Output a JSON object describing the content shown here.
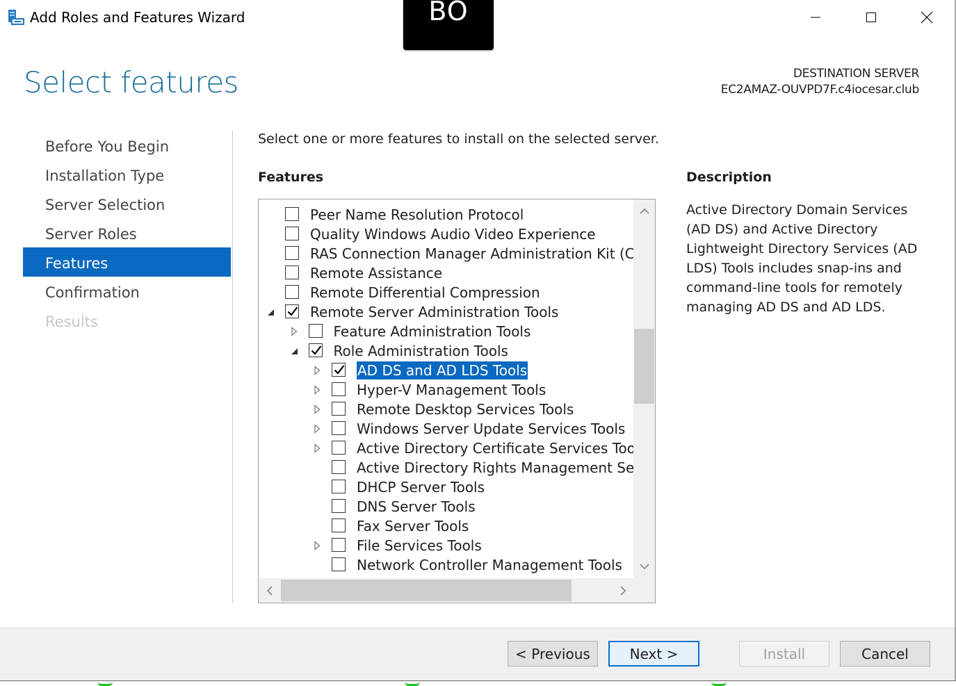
{
  "window": {
    "title": "Add Roles and Features Wizard",
    "overlay_text": "BO"
  },
  "page": {
    "title": "Select features",
    "destination_label": "DESTINATION SERVER",
    "destination_server": "EC2AMAZ-OUVPD7F.c4iocesar.club"
  },
  "nav": {
    "items": [
      {
        "label": "Before You Begin",
        "state": "normal"
      },
      {
        "label": "Installation Type",
        "state": "normal"
      },
      {
        "label": "Server Selection",
        "state": "normal"
      },
      {
        "label": "Server Roles",
        "state": "normal"
      },
      {
        "label": "Features",
        "state": "active"
      },
      {
        "label": "Confirmation",
        "state": "normal"
      },
      {
        "label": "Results",
        "state": "disabled"
      }
    ]
  },
  "content": {
    "intro": "Select one or more features to install on the selected server.",
    "features_heading": "Features",
    "description_heading": "Description",
    "description": "Active Directory Domain Services (AD DS) and Active Directory Lightweight Directory Services (AD LDS) Tools includes snap-ins and command-line tools for remotely managing AD DS and AD LDS."
  },
  "features": [
    {
      "label": "Peer Name Resolution Protocol",
      "checked": false,
      "level": 0,
      "expander": "none"
    },
    {
      "label": "Quality Windows Audio Video Experience",
      "checked": false,
      "level": 0,
      "expander": "none"
    },
    {
      "label": "RAS Connection Manager Administration Kit (CMA",
      "checked": false,
      "level": 0,
      "expander": "none"
    },
    {
      "label": "Remote Assistance",
      "checked": false,
      "level": 0,
      "expander": "none"
    },
    {
      "label": "Remote Differential Compression",
      "checked": false,
      "level": 0,
      "expander": "none"
    },
    {
      "label": "Remote Server Administration Tools",
      "checked": true,
      "level": 0,
      "expander": "expanded"
    },
    {
      "label": "Feature Administration Tools",
      "checked": false,
      "level": 1,
      "expander": "collapsed"
    },
    {
      "label": "Role Administration Tools",
      "checked": true,
      "level": 1,
      "expander": "expanded"
    },
    {
      "label": "AD DS and AD LDS Tools",
      "checked": true,
      "level": 2,
      "expander": "collapsed",
      "selected": true
    },
    {
      "label": "Hyper-V Management Tools",
      "checked": false,
      "level": 2,
      "expander": "collapsed"
    },
    {
      "label": "Remote Desktop Services Tools",
      "checked": false,
      "level": 2,
      "expander": "collapsed"
    },
    {
      "label": "Windows Server Update Services Tools",
      "checked": false,
      "level": 2,
      "expander": "collapsed"
    },
    {
      "label": "Active Directory Certificate Services Tools",
      "checked": false,
      "level": 2,
      "expander": "collapsed"
    },
    {
      "label": "Active Directory Rights Management Servic",
      "checked": false,
      "level": 2,
      "expander": "none"
    },
    {
      "label": "DHCP Server Tools",
      "checked": false,
      "level": 2,
      "expander": "none"
    },
    {
      "label": "DNS Server Tools",
      "checked": false,
      "level": 2,
      "expander": "none"
    },
    {
      "label": "Fax Server Tools",
      "checked": false,
      "level": 2,
      "expander": "none"
    },
    {
      "label": "File Services Tools",
      "checked": false,
      "level": 2,
      "expander": "collapsed"
    },
    {
      "label": "Network Controller Management Tools",
      "checked": false,
      "level": 2,
      "expander": "none"
    }
  ],
  "buttons": {
    "previous": "< Previous",
    "next": "Next >",
    "install": "Install",
    "cancel": "Cancel"
  },
  "icons": {
    "app": "server-manager-icon",
    "minimize": "minimize-icon",
    "maximize": "maximize-icon",
    "close": "close-icon"
  },
  "colors": {
    "accent": "#0a69c0",
    "title": "#1a6d99"
  }
}
